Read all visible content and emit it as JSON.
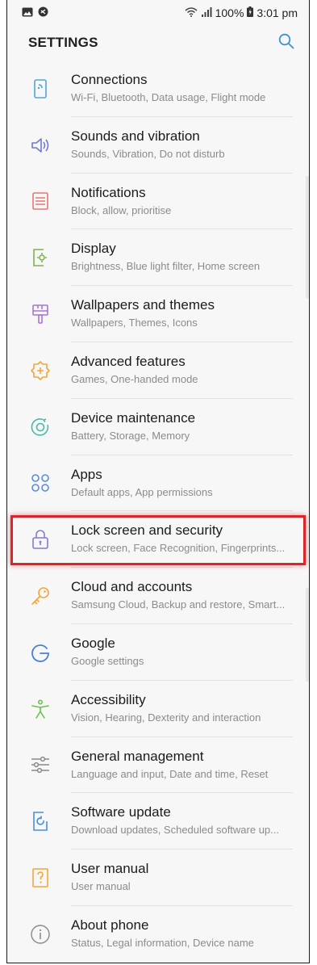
{
  "status": {
    "battery": "100%",
    "time": "3:01 pm"
  },
  "header": {
    "title": "SETTINGS"
  },
  "items": [
    {
      "title": "Connections",
      "subtitle": "Wi-Fi, Bluetooth, Data usage, Flight mode",
      "icon": "connections-icon",
      "color": "#4ba7d8"
    },
    {
      "title": "Sounds and vibration",
      "subtitle": "Sounds, Vibration, Do not disturb",
      "icon": "speaker-icon",
      "color": "#6e79d8"
    },
    {
      "title": "Notifications",
      "subtitle": "Block, allow, prioritise",
      "icon": "notifications-icon",
      "color": "#e57670"
    },
    {
      "title": "Display",
      "subtitle": "Brightness, Blue light filter, Home screen",
      "icon": "display-icon",
      "color": "#7bb34f"
    },
    {
      "title": "Wallpapers and themes",
      "subtitle": "Wallpapers, Themes, Icons",
      "icon": "paintbrush-icon",
      "color": "#a876d1"
    },
    {
      "title": "Advanced features",
      "subtitle": "Games, One-handed mode",
      "icon": "advanced-features-icon",
      "color": "#f0a73a"
    },
    {
      "title": "Device maintenance",
      "subtitle": "Battery, Storage, Memory",
      "icon": "device-maintenance-icon",
      "color": "#49b8a6"
    },
    {
      "title": "Apps",
      "subtitle": "Default apps, App permissions",
      "icon": "apps-icon",
      "color": "#5d8ad8"
    },
    {
      "title": "Lock screen and security",
      "subtitle": "Lock screen, Face Recognition, Fingerprints...",
      "icon": "lock-icon",
      "color": "#8a78d0"
    },
    {
      "title": "Cloud and accounts",
      "subtitle": "Samsung Cloud, Backup and restore, Smart...",
      "icon": "key-icon",
      "color": "#f0a73a"
    },
    {
      "title": "Google",
      "subtitle": "Google settings",
      "icon": "google-icon",
      "color": "#4a7fd8"
    },
    {
      "title": "Accessibility",
      "subtitle": "Vision, Hearing, Dexterity and interaction",
      "icon": "accessibility-icon",
      "color": "#6cc24a"
    },
    {
      "title": "General management",
      "subtitle": "Language and input, Date and time, Reset",
      "icon": "sliders-icon",
      "color": "#8a8a8a"
    },
    {
      "title": "Software update",
      "subtitle": "Download updates, Scheduled software up...",
      "icon": "software-update-icon",
      "color": "#4a8fd8"
    },
    {
      "title": "User manual",
      "subtitle": "User manual",
      "icon": "user-manual-icon",
      "color": "#f0a73a"
    },
    {
      "title": "About phone",
      "subtitle": "Status, Legal information, Device name",
      "icon": "info-icon",
      "color": "#8a8a8a"
    }
  ],
  "highlighted_item": "Lock screen and security",
  "highlight_color": "#d9262a"
}
